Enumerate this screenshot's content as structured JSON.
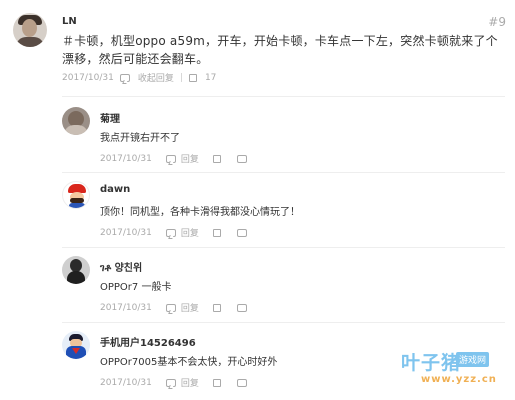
{
  "main_post": {
    "username": "LN",
    "floor": "#9",
    "text": "＃卡顿，机型oppo a59m，开车，开始卡顿，卡车点一下左，突然卡顿就来了个漂移，然后可能还会翻车。",
    "date": "2017/10/31",
    "reply_label": "收起回复",
    "like_count": "17"
  },
  "replies": [
    {
      "username": "菊理",
      "text": "我点开镜右开不了",
      "date": "2017/10/31",
      "reply_label": "回复"
    },
    {
      "username": "dawn",
      "text": "顶你！同机型，各种卡滑得我都没心情玩了！",
      "date": "2017/10/31",
      "reply_label": "回复"
    },
    {
      "username": "ገቶ 양친위",
      "text": "OPPOr7  一般卡",
      "date": "2017/10/31",
      "reply_label": "回复"
    },
    {
      "username": "手机用户14526496",
      "text": "OPPOr7005基本不会太快，开心时好外",
      "date": "2017/10/31",
      "reply_label": "回复"
    }
  ],
  "watermark": {
    "title": "叶子猪",
    "badge": "游戏网",
    "url": "www.yzz.cn"
  }
}
